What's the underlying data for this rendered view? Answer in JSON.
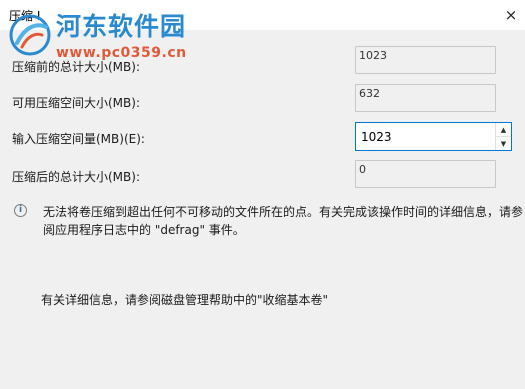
{
  "window": {
    "title": "压缩 I",
    "close_icon": "×"
  },
  "watermark": {
    "name": "河东软件园",
    "url": "www.pc0359.cn"
  },
  "fields": {
    "total_before_label": "压缩前的总计大小(MB):",
    "total_before_value": "1023",
    "available_label": "可用压缩空间大小(MB):",
    "available_value": "632",
    "shrink_amount_label": "输入压缩空间量(MB)(E):",
    "shrink_amount_value": "1023",
    "total_after_label": "压缩后的总计大小(MB):",
    "total_after_value": "0"
  },
  "info": {
    "icon": "i",
    "text": "无法将卷压缩到超出任何不可移动的文件所在的点。有关完成该操作时间的详细信息，请参阅应用程序日志中的 \"defrag\" 事件。"
  },
  "footer": {
    "text": "有关详细信息，请参阅磁盘管理帮助中的\"收缩基本卷\""
  },
  "spin": {
    "up": "▲",
    "down": "▼"
  }
}
